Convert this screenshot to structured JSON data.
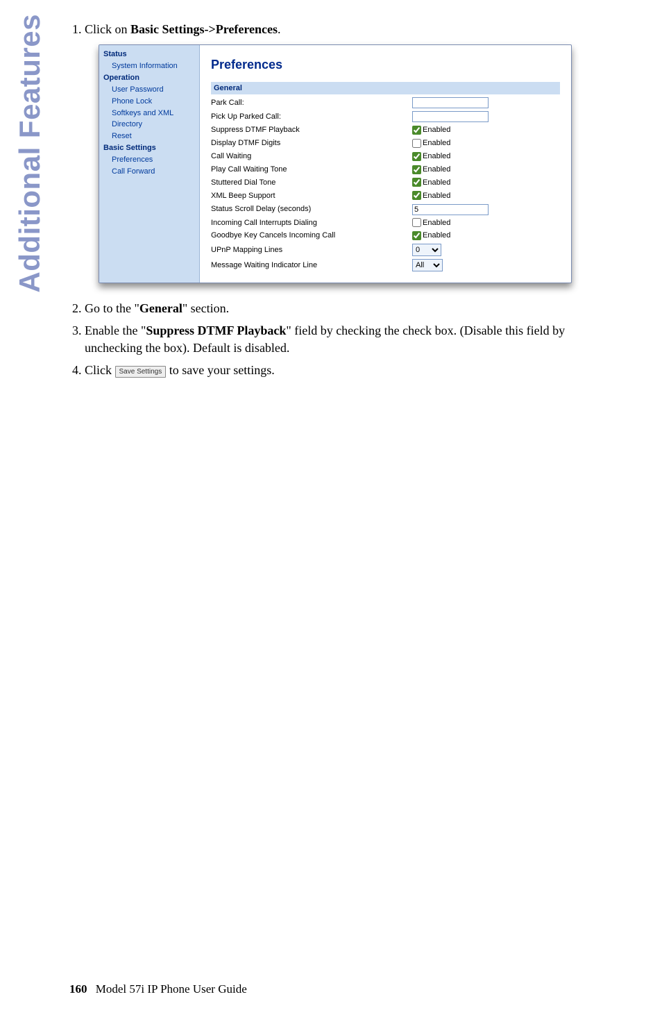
{
  "side_heading": "Additional Features",
  "steps": {
    "s1_pre": "Click on ",
    "s1_bold": "Basic Settings->Preferences",
    "s1_post": ".",
    "s2_pre": "Go to the \"",
    "s2_bold": "General",
    "s2_post": "\" section",
    "s2_period": ".",
    "s3_pre": "Enable the \"",
    "s3_bold": "Suppress DTMF Playback",
    "s3_post": "\" field by checking the check box. (Disable this field by unchecking the box). Default is disabled.",
    "s4_pre": "Click ",
    "s4_btn": "Save Settings",
    "s4_post": " to save your settings."
  },
  "ui": {
    "sidebar": {
      "status": "Status",
      "sysinfo": "System Information",
      "operation": "Operation",
      "userpwd": "User Password",
      "phonelock": "Phone Lock",
      "softkeys": "Softkeys and XML",
      "directory": "Directory",
      "reset": "Reset",
      "basics": "Basic Settings",
      "prefs": "Preferences",
      "callfwd": "Call Forward"
    },
    "title": "Preferences",
    "section": "General",
    "rows": {
      "park": "Park Call:",
      "pickup": "Pick Up Parked Call:",
      "suppress": "Suppress DTMF Playback",
      "display": "Display DTMF Digits",
      "callwait": "Call Waiting",
      "playtone": "Play Call Waiting Tone",
      "stutter": "Stuttered Dial Tone",
      "xmlbeep": "XML Beep Support",
      "scroll": "Status Scroll Delay (seconds)",
      "incoming": "Incoming Call Interrupts Dialing",
      "goodbye": "Goodbye Key Cancels Incoming Call",
      "upnp": "UPnP Mapping Lines",
      "mwi": "Message Waiting Indicator Line"
    },
    "enabled_label": "Enabled",
    "values": {
      "park": "",
      "pickup": "",
      "scroll": "5",
      "upnp": "0",
      "mwi": "All"
    },
    "checked": {
      "suppress": true,
      "display": false,
      "callwait": true,
      "playtone": true,
      "stutter": true,
      "xmlbeep": true,
      "incoming": false,
      "goodbye": true
    }
  },
  "footer": {
    "page": "160",
    "text": "Model 57i IP Phone User Guide"
  }
}
